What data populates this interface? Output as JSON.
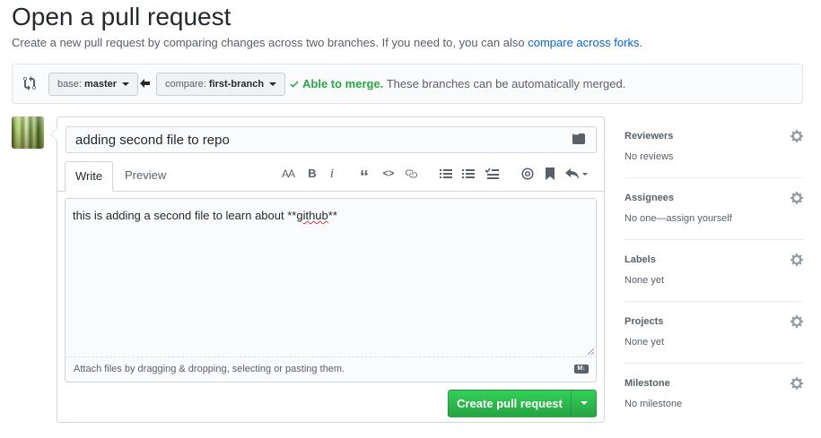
{
  "header": {
    "title": "Open a pull request",
    "subtitle_prefix": "Create a new pull request by comparing changes across two branches. If you need to, you can also ",
    "subtitle_link": "compare across forks",
    "subtitle_suffix": "."
  },
  "range": {
    "base_label": "base:",
    "base_value": "master",
    "compare_label": "compare:",
    "compare_value": "first-branch",
    "merge_ok": "Able to merge.",
    "merge_detail": "These branches can be automatically merged."
  },
  "composer": {
    "title_value": "adding second file to repo",
    "tabs": [
      "Write",
      "Preview"
    ],
    "body_prefix": "this is adding a second file to learn about **",
    "body_spell": "github",
    "body_suffix": "**",
    "attach_text": "Attach files by dragging & dropping, selecting or pasting them.",
    "markdown_badge": "M↓",
    "toolbar_icons": [
      "header-icon",
      "bold-icon",
      "italic-icon",
      "quote-icon",
      "code-icon",
      "link-icon",
      "bulleted-list-icon",
      "numbered-list-icon",
      "task-list-icon",
      "mention-icon",
      "reference-icon",
      "reply-icon"
    ],
    "toolbar_glyphs": {
      "header": "AA",
      "bold": "B",
      "italic": "i",
      "quote": "“",
      "code": "<>"
    },
    "create_button": "Create pull request"
  },
  "sidebar": {
    "sections": [
      {
        "title": "Reviewers",
        "value": "No reviews"
      },
      {
        "title": "Assignees",
        "value": "No one—assign yourself"
      },
      {
        "title": "Labels",
        "value": "None yet"
      },
      {
        "title": "Projects",
        "value": "None yet"
      },
      {
        "title": "Milestone",
        "value": "No milestone"
      }
    ]
  },
  "colors": {
    "accent_link": "#0366d6",
    "merge_green": "#28a745",
    "button_green": "#2cbe4e"
  }
}
